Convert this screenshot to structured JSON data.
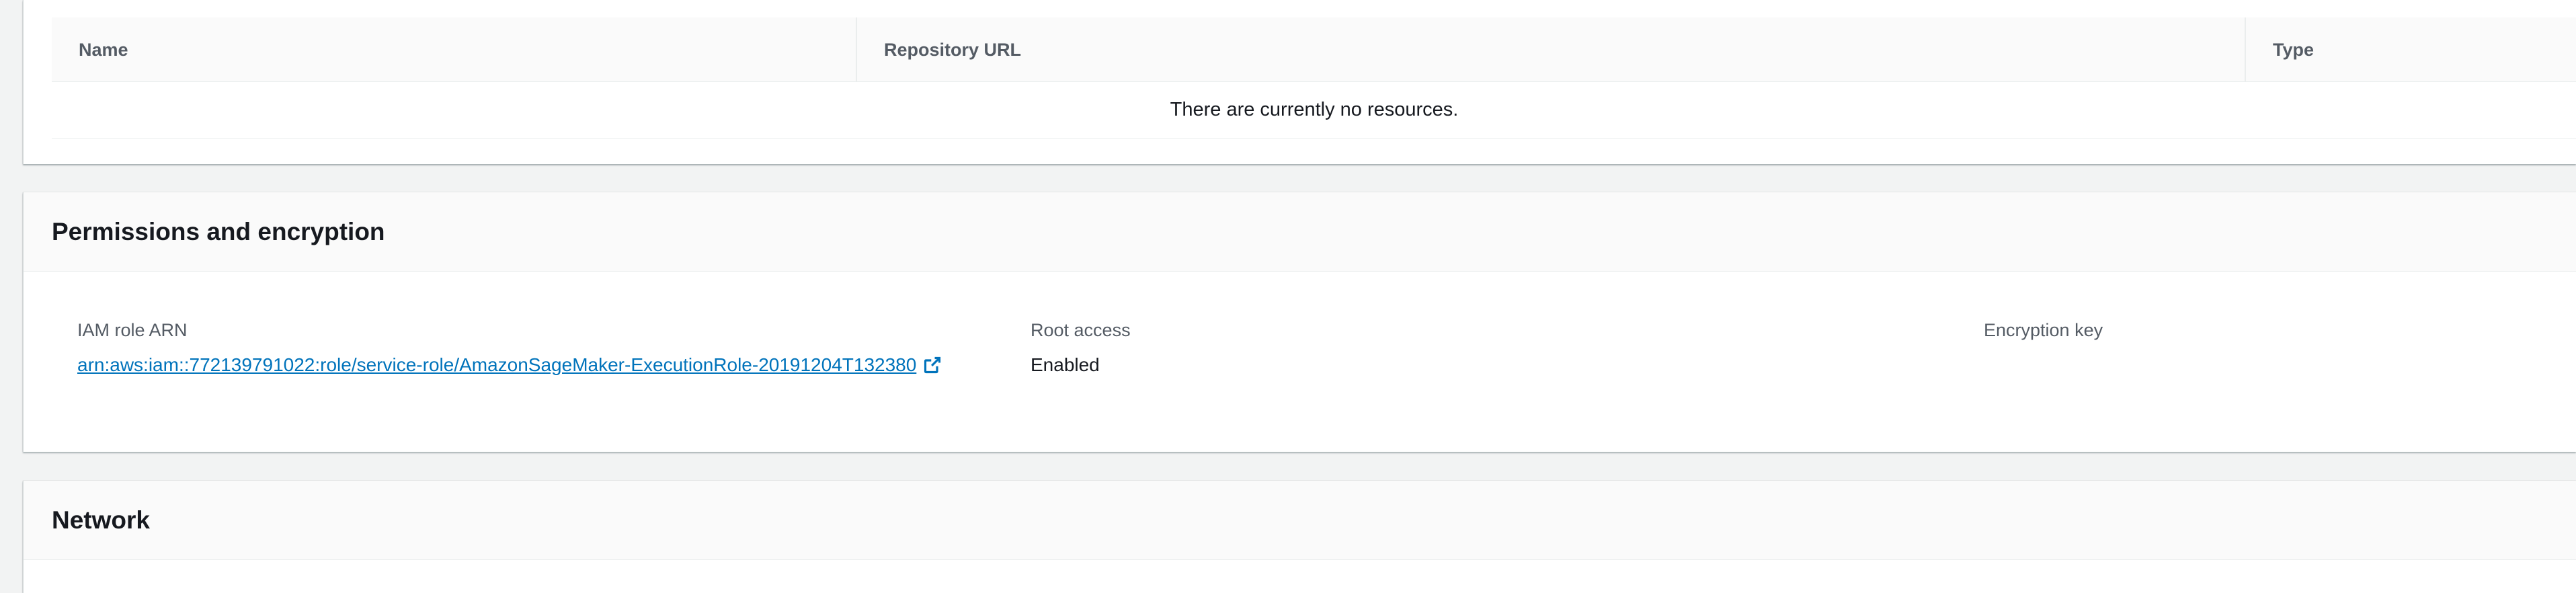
{
  "repositories_table": {
    "columns": [
      "Name",
      "Repository URL",
      "Type"
    ],
    "empty_message": "There are currently no resources."
  },
  "permissions": {
    "title": "Permissions and encryption",
    "iam_role": {
      "label": "IAM role ARN",
      "value": "arn:aws:iam::772139791022:role/service-role/AmazonSageMaker-ExecutionRole-20191204T132380",
      "icon": "external-link-icon"
    },
    "root_access": {
      "label": "Root access",
      "value": "Enabled"
    },
    "encryption_key": {
      "label": "Encryption key",
      "value": ""
    }
  },
  "network": {
    "title": "Network"
  },
  "colors": {
    "link": "#0073bb",
    "page_background": "#f2f3f3",
    "header_background": "#fafafa",
    "muted_text": "#545b64"
  }
}
